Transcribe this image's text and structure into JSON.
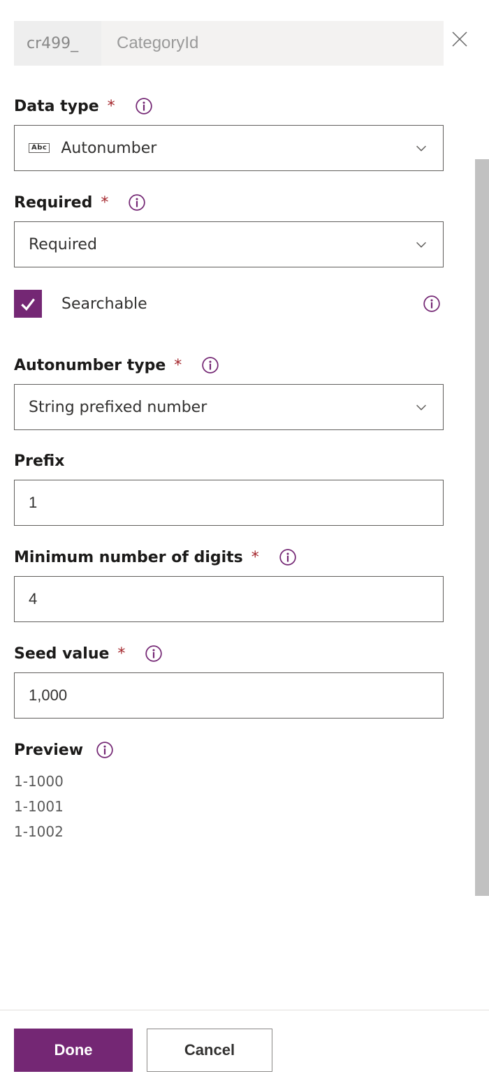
{
  "name_prefix": "cr499_",
  "name_placeholder": "CategoryId",
  "name_value": "",
  "fields": {
    "data_type": {
      "label": "Data type",
      "value": "Autonumber"
    },
    "required": {
      "label": "Required",
      "value": "Required"
    },
    "searchable": {
      "label": "Searchable",
      "checked": true
    },
    "autonumber_type": {
      "label": "Autonumber type",
      "value": "String prefixed number"
    },
    "prefix": {
      "label": "Prefix",
      "value": "1"
    },
    "min_digits": {
      "label": "Minimum number of digits",
      "value": "4"
    },
    "seed": {
      "label": "Seed value",
      "value": "1,000"
    },
    "preview": {
      "label": "Preview",
      "lines": [
        "1-1000",
        "1-1001",
        "1-1002"
      ]
    }
  },
  "buttons": {
    "done": "Done",
    "cancel": "Cancel"
  },
  "colors": {
    "accent": "#742774"
  }
}
